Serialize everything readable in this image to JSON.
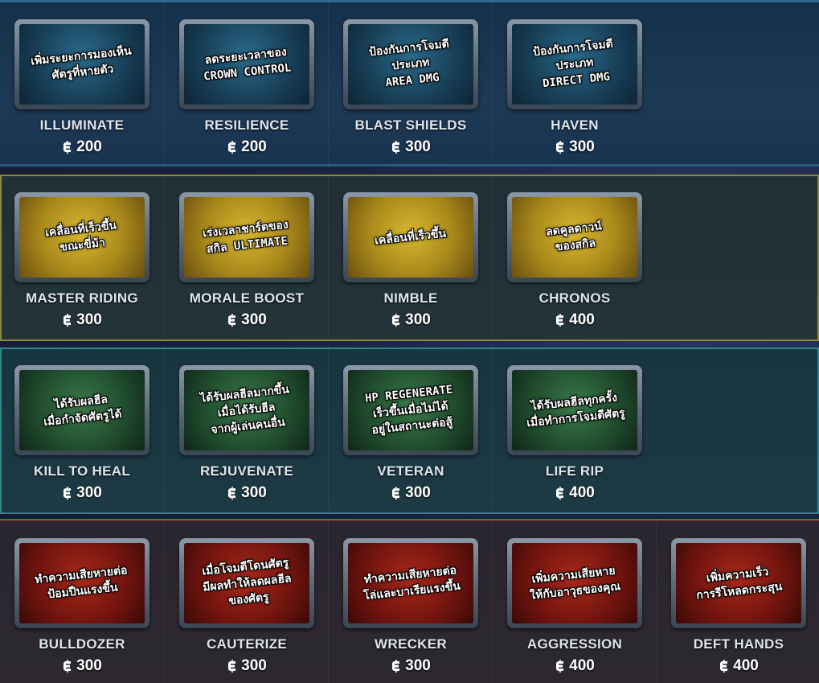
{
  "rows": [
    {
      "theme": "blue",
      "cards": [
        {
          "name": "ILLUMINATE",
          "price": "200",
          "desc": "เพิ่มระยะการมองเห็น\nศัตรูที่หายตัว"
        },
        {
          "name": "RESILIENCE",
          "price": "200",
          "desc": "ลดระยะเวลาของ\nCROWN CONTROL"
        },
        {
          "name": "BLAST SHIELDS",
          "price": "300",
          "desc": "ป้องกันการโจมตีประเภท\nAREA DMG"
        },
        {
          "name": "HAVEN",
          "price": "300",
          "desc": "ป้องกันการโจมตีประเภท\nDIRECT DMG"
        }
      ]
    },
    {
      "theme": "yellow",
      "cards": [
        {
          "name": "MASTER RIDING",
          "price": "300",
          "desc": "เคลื่อนที่เร็วขึ้น\nขณะขี่ม้า"
        },
        {
          "name": "MORALE BOOST",
          "price": "300",
          "desc": "เร่งเวลาชาร์ตของ\nสกิล ULTIMATE"
        },
        {
          "name": "NIMBLE",
          "price": "300",
          "desc": "เคลื่อนที่เร็วขึ้น"
        },
        {
          "name": "CHRONOS",
          "price": "400",
          "desc": "ลดคูลดาวน์\nของสกิล"
        }
      ]
    },
    {
      "theme": "green",
      "cards": [
        {
          "name": "KILL TO HEAL",
          "price": "300",
          "desc": "ได้รับผลฮีล\nเมื่อกำจัดศัตรูได้"
        },
        {
          "name": "REJUVENATE",
          "price": "300",
          "desc": "ได้รับผลฮีลมากขึ้น\nเมื่อได้รับฮีล\nจากผู้เล่นคนอื่น"
        },
        {
          "name": "VETERAN",
          "price": "300",
          "desc": "HP REGENERATE\nเร็วขึ้นเมื่อไม่ได้\nอยู่ในสถานะต่อสู้"
        },
        {
          "name": "LIFE RIP",
          "price": "400",
          "desc": "ได้รับผลฮีลทุกครั้ง\nเมื่อทำการโจมตีศัตรู"
        }
      ]
    },
    {
      "theme": "red",
      "cards": [
        {
          "name": "BULLDOZER",
          "price": "300",
          "desc": "ทำความเสียหายต่อ\nป้อมปืนแรงขึ้น"
        },
        {
          "name": "CAUTERIZE",
          "price": "300",
          "desc": "เมื่อโจมตีโดนศัตรู\nมีผลทำให้ลดผลฮีล\nของศัตรู"
        },
        {
          "name": "WRECKER",
          "price": "300",
          "desc": "ทำความเสียหายต่อ\nโล่และบาเรียแรงขึ้น"
        },
        {
          "name": "AGGRESSION",
          "price": "400",
          "desc": "เพิ่มความเสียหาย\nให้กับอาวุธของคุณ"
        },
        {
          "name": "DEFT HANDS",
          "price": "400",
          "desc": "เพิ่มความเร็ว\nการรีโหลดกระสุน"
        }
      ]
    }
  ],
  "currency_icon": "credit-icon"
}
